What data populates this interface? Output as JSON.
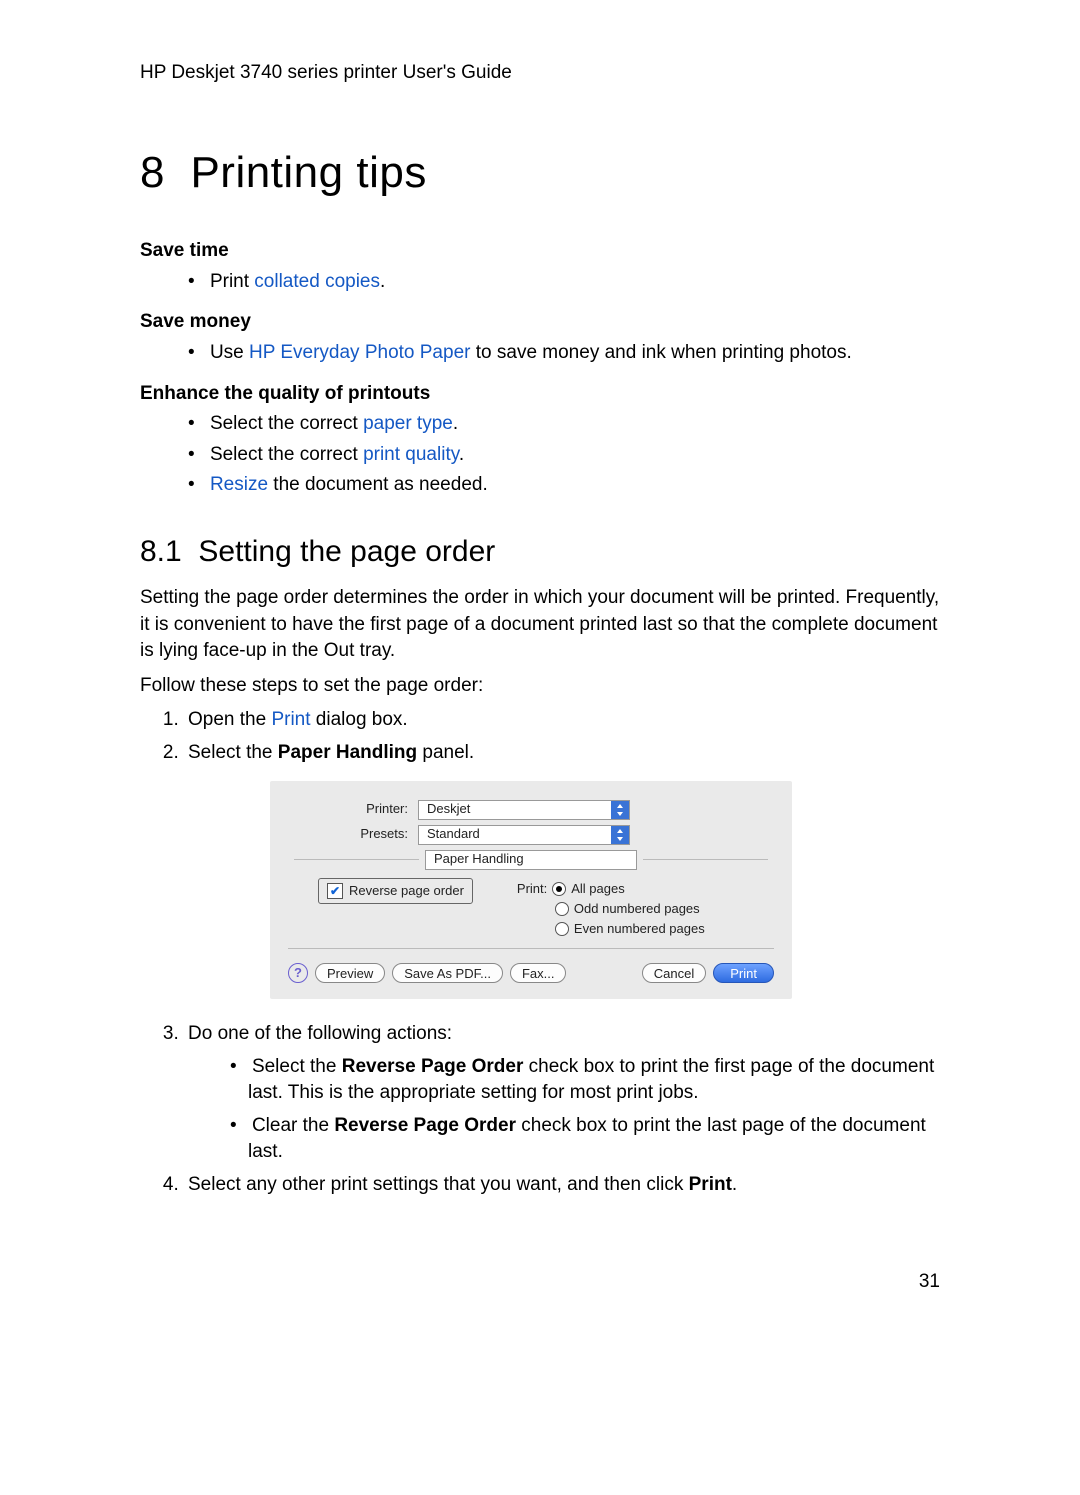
{
  "header": "HP Deskjet 3740 series printer User's Guide",
  "chapter": {
    "number": "8",
    "title": "Printing tips"
  },
  "tips": {
    "save_time": {
      "heading": "Save time",
      "item_prefix": "Print ",
      "item_link": "collated copies",
      "item_suffix": "."
    },
    "save_money": {
      "heading": "Save money",
      "item_prefix": "Use ",
      "item_link": "HP Everyday Photo Paper",
      "item_suffix": " to save money and ink when printing photos."
    },
    "enhance": {
      "heading": "Enhance the quality of printouts",
      "items": [
        {
          "prefix": "Select the correct ",
          "link": "paper type",
          "suffix": "."
        },
        {
          "prefix": "Select the correct ",
          "link": "print quality",
          "suffix": "."
        },
        {
          "prefix": "",
          "link": "Resize",
          "suffix": " the document as needed."
        }
      ]
    }
  },
  "section": {
    "number": "8.1",
    "title": "Setting the page order",
    "intro": "Setting the page order determines the order in which your document will be printed. Frequently, it is convenient to have the first page of a document printed last so that the complete document is lying face-up in the Out tray.",
    "follow": "Follow these steps to set the page order:",
    "steps": {
      "s1": {
        "prefix": "Open the ",
        "link": "Print",
        "suffix": " dialog box."
      },
      "s2": {
        "prefix": "Select the ",
        "bold": "Paper Handling",
        "suffix": " panel."
      },
      "s3": {
        "lead": "Do one of the following actions:",
        "a": {
          "prefix": "Select the ",
          "bold": "Reverse Page Order",
          "suffix": " check box to print the first page of the document last. This is the appropriate setting for most print jobs."
        },
        "b": {
          "prefix": "Clear the ",
          "bold": "Reverse Page Order",
          "suffix": " check box to print the last page of the document last."
        }
      },
      "s4": {
        "prefix": "Select any other print settings that you want, and then click ",
        "bold": "Print",
        "suffix": "."
      }
    }
  },
  "dialog": {
    "printer_label": "Printer:",
    "printer_value": "Deskjet",
    "presets_label": "Presets:",
    "presets_value": "Standard",
    "panel_value": "Paper Handling",
    "reverse_label": "Reverse page order",
    "print_label": "Print:",
    "opt_all": "All pages",
    "opt_odd": "Odd numbered pages",
    "opt_even": "Even numbered pages",
    "help": "?",
    "btn_preview": "Preview",
    "btn_savepdf": "Save As PDF...",
    "btn_fax": "Fax...",
    "btn_cancel": "Cancel",
    "btn_print": "Print"
  },
  "page_number": "31"
}
